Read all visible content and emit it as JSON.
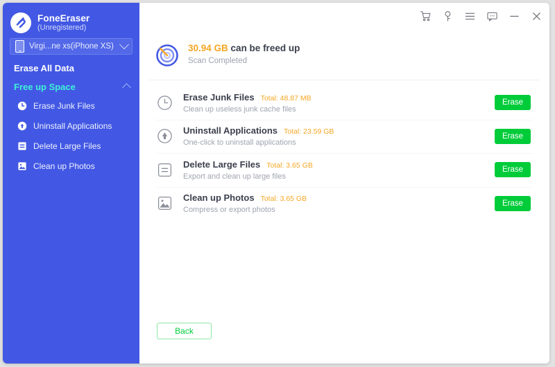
{
  "window": {
    "brand_name": "FoneEraser",
    "brand_sub": "(Unregistered)"
  },
  "titlebar": {
    "buttons": [
      {
        "name": "cart-icon",
        "label": "Cart"
      },
      {
        "name": "key-icon",
        "label": "Register"
      },
      {
        "name": "menu-icon",
        "label": "Menu"
      },
      {
        "name": "feedback-icon",
        "label": "Feedback"
      },
      {
        "name": "minimize-icon",
        "label": "Minimize"
      },
      {
        "name": "close-icon",
        "label": "Close"
      }
    ]
  },
  "sidebar": {
    "device": {
      "label": "Virgi...ne xs(iPhone XS)",
      "icon": "phone-icon",
      "chevron": "chevron-down-icon"
    },
    "erase_all_data": "Erase All Data",
    "section": {
      "title": "Free up Space",
      "chevron": "chevron-up-icon",
      "accent_color": "#3ff0d8"
    },
    "items": [
      {
        "label": "Erase Junk Files",
        "icon": "clock-icon"
      },
      {
        "label": "Uninstall Applications",
        "icon": "app-uninstall-icon"
      },
      {
        "label": "Delete Large Files",
        "icon": "file-lines-icon"
      },
      {
        "label": "Clean up Photos",
        "icon": "photo-icon"
      }
    ]
  },
  "main": {
    "scan": {
      "amount": "30.94 GB",
      "headline_rest": " can be freed up",
      "status": "Scan Completed",
      "icon": "radar-scan-icon"
    },
    "rows": [
      {
        "title": "Erase Junk Files",
        "total": "Total: 48.87 MB",
        "desc": "Clean up useless junk cache files",
        "icon": "clock-icon",
        "action": "Erase"
      },
      {
        "title": "Uninstall Applications",
        "total": "Total: 23.59 GB",
        "desc": "One-click to uninstall applications",
        "icon": "app-uninstall-icon",
        "action": "Erase"
      },
      {
        "title": "Delete Large Files",
        "total": "Total: 3.65 GB",
        "desc": "Export and clean up large files",
        "icon": "file-lines-icon",
        "action": "Erase"
      },
      {
        "title": "Clean up Photos",
        "total": "Total: 3.65 GB",
        "desc": "Compress or export photos",
        "icon": "photo-icon",
        "action": "Erase"
      }
    ],
    "back_label": "Back"
  },
  "colors": {
    "sidebar_blue": "#4258e4",
    "accent_cyan": "#3ff0d8",
    "amount_orange": "#f5a623",
    "action_green": "#00cc3a"
  }
}
